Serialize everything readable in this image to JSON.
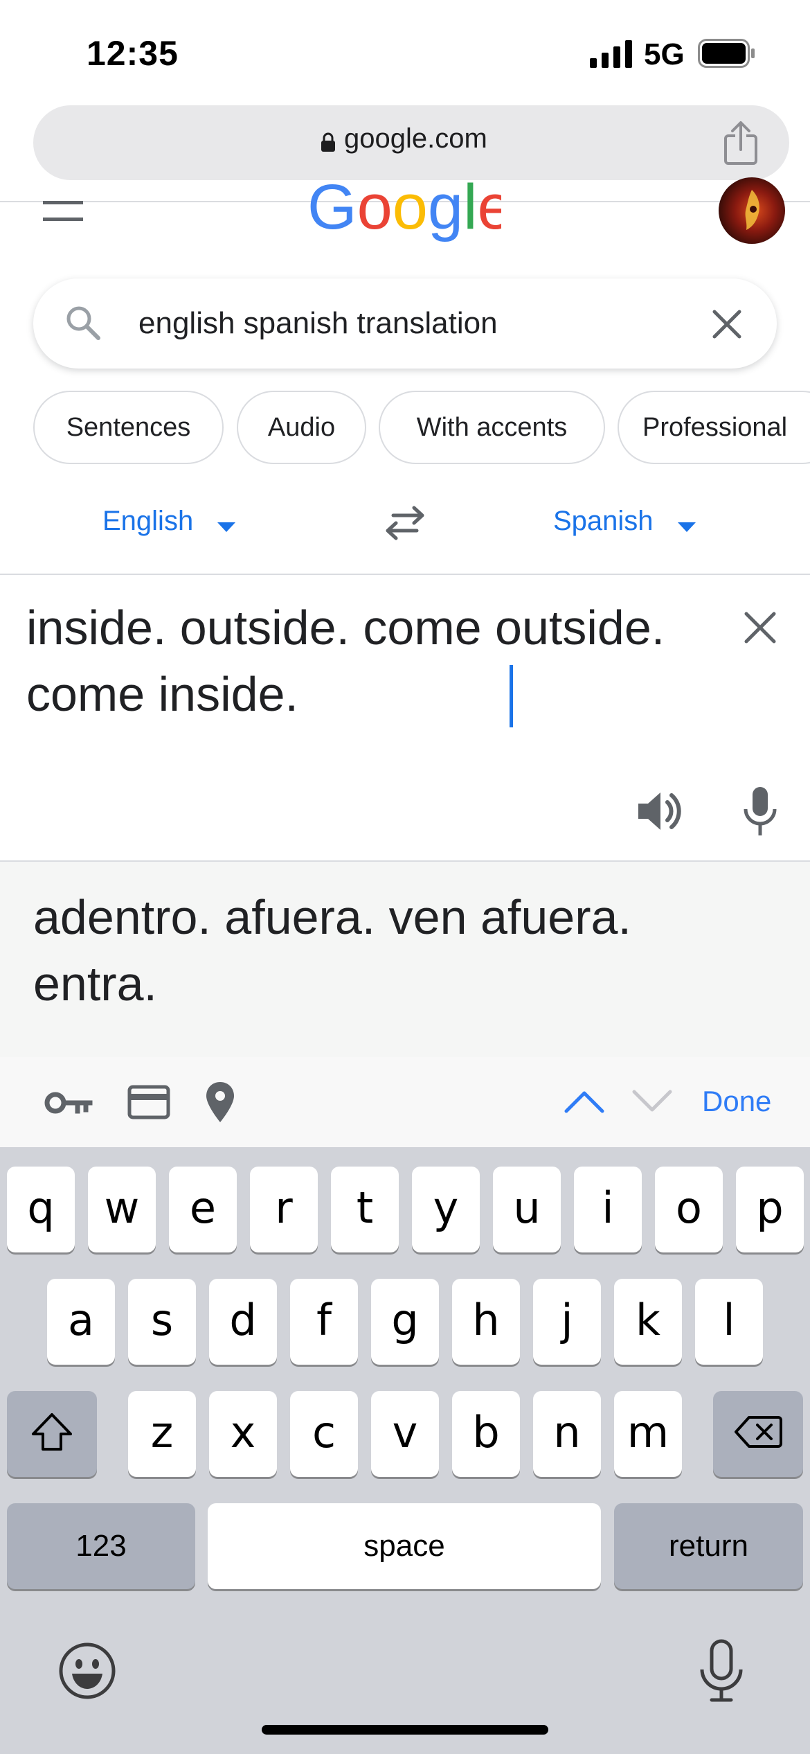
{
  "status_bar": {
    "time": "12:35",
    "network": "5G"
  },
  "browser": {
    "url": "google.com"
  },
  "search": {
    "query": "english spanish translation"
  },
  "chips": [
    "Sentences",
    "Audio",
    "With accents",
    "Professional"
  ],
  "translator": {
    "source_language": "English",
    "target_language": "Spanish",
    "source_text": "inside. outside. come outside. come inside.",
    "translation": "adentro. afuera. ven afuera. entra."
  },
  "accessory_bar": {
    "done_label": "Done"
  },
  "keyboard": {
    "row1": [
      "q",
      "w",
      "e",
      "r",
      "t",
      "y",
      "u",
      "i",
      "o",
      "p"
    ],
    "row2": [
      "a",
      "s",
      "d",
      "f",
      "g",
      "h",
      "j",
      "k",
      "l"
    ],
    "row3": [
      "z",
      "x",
      "c",
      "v",
      "b",
      "n",
      "m"
    ],
    "numbers_label": "123",
    "space_label": "space",
    "return_label": "return"
  },
  "colors": {
    "accent": "#1a73e8",
    "keyboard_bg": "#d1d3d9",
    "translation_bg": "#f5f6f5"
  },
  "icons": [
    "signal-icon",
    "battery-icon",
    "lock-icon",
    "share-icon",
    "menu-icon",
    "search-icon",
    "clear-icon",
    "swap-icon",
    "speaker-icon",
    "mic-icon",
    "key-icon",
    "card-icon",
    "location-icon",
    "chevron-up-icon",
    "chevron-down-icon",
    "shift-icon",
    "backspace-icon",
    "emoji-icon",
    "dictation-icon"
  ]
}
